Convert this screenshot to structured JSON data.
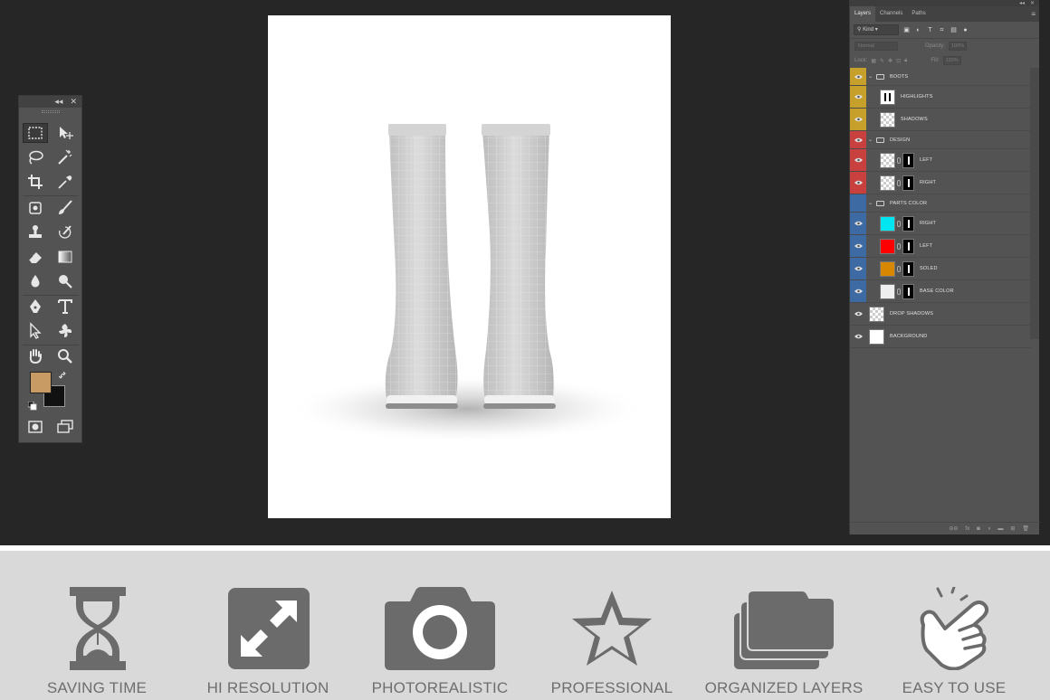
{
  "colors": {
    "workspace": "#262626",
    "panel": "#535353",
    "foreground_swatch": "#c89a64",
    "background_swatch": "#111111",
    "group_boots": "#c7a02c",
    "group_design": "#c8413f",
    "group_parts": "#3d6aa3",
    "color_right": "#00e5f0",
    "color_left": "#ff0000",
    "color_soled": "#d88800",
    "feature_icon": "#6b6b6b"
  },
  "tools_panel": {
    "collapse_label": "◂◂",
    "close_label": "✕"
  },
  "layers_panel": {
    "tabs": [
      "Layers",
      "Channels",
      "Paths"
    ],
    "kind_label": "Kind",
    "blend_mode": "Normal",
    "opacity_label": "Opacity:",
    "opacity_value": "100%",
    "lock_label": "Lock:",
    "fill_label": "Fill:",
    "fill_value": "100%",
    "layers": [
      {
        "name": "BOOTS",
        "type": "group",
        "group": "boots"
      },
      {
        "name": "HIGHLIGHTS",
        "type": "layer",
        "group": "boots",
        "thumb": "mask"
      },
      {
        "name": "SHADOWS",
        "type": "layer",
        "group": "boots",
        "thumb": "checker"
      },
      {
        "name": "DESIGN",
        "type": "group",
        "group": "design"
      },
      {
        "name": "LEFT",
        "type": "smart",
        "group": "design"
      },
      {
        "name": "RIGHT",
        "type": "smart",
        "group": "design"
      },
      {
        "name": "PARTS COLOR",
        "type": "group",
        "group": "parts"
      },
      {
        "name": "RIGHT",
        "type": "color",
        "group": "parts",
        "color": "#00e5f0"
      },
      {
        "name": "LEFT",
        "type": "color",
        "group": "parts",
        "color": "#ff0000"
      },
      {
        "name": "SOLED",
        "type": "color",
        "group": "parts",
        "color": "#d88800"
      },
      {
        "name": "BASE COLOR",
        "type": "color",
        "group": "parts",
        "color": "#efefef"
      },
      {
        "name": "DROP SHADOWS",
        "type": "layer",
        "group": "none",
        "thumb": "checker"
      },
      {
        "name": "BACKGROUND",
        "type": "layer",
        "group": "none",
        "thumb": "white"
      }
    ]
  },
  "features": [
    {
      "label": "SAVING TIME",
      "icon": "hourglass-icon"
    },
    {
      "label": "HI RESOLUTION",
      "icon": "expand-arrows-icon"
    },
    {
      "label": "PHOTOREALISTIC",
      "icon": "camera-icon"
    },
    {
      "label": "PROFESSIONAL",
      "icon": "star-icon"
    },
    {
      "label": "ORGANIZED LAYERS",
      "icon": "folders-icon"
    },
    {
      "label": "EASY TO USE",
      "icon": "hand-tap-icon"
    }
  ]
}
